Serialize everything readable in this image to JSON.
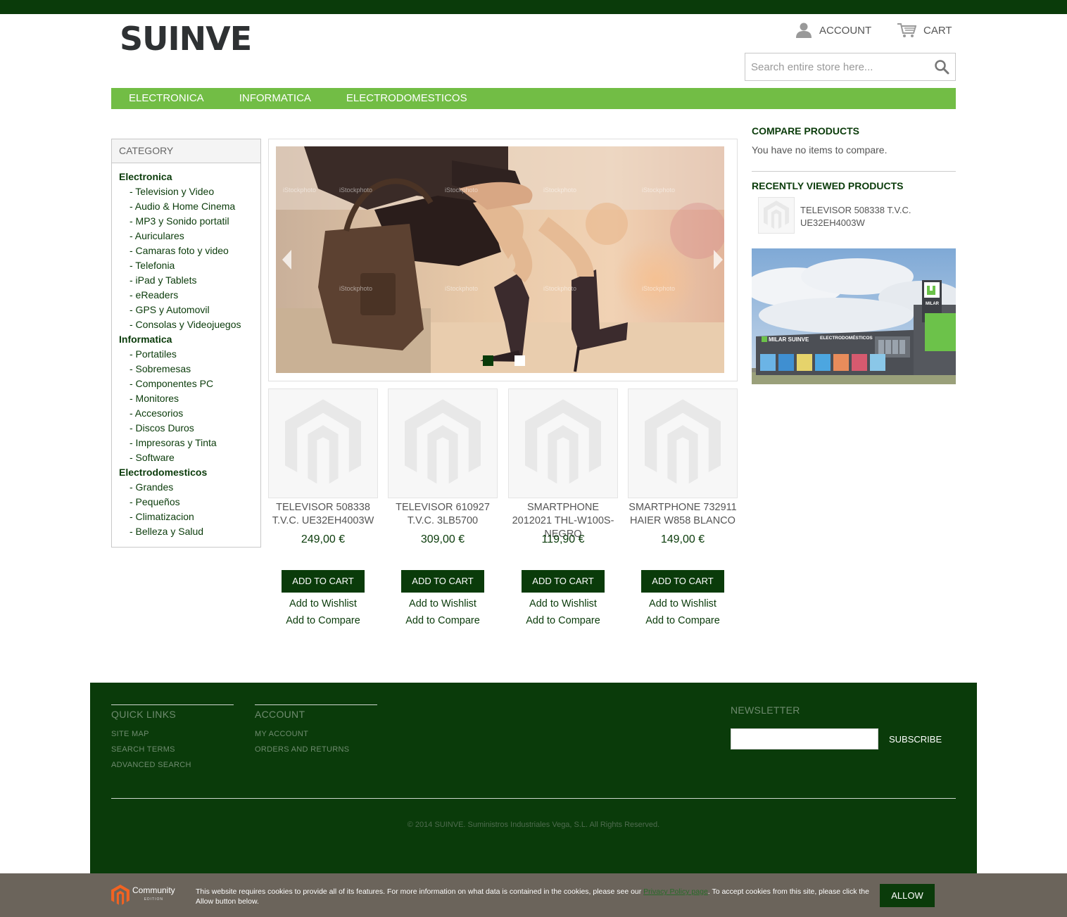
{
  "header": {
    "logo": "SUINVE",
    "account_label": "ACCOUNT",
    "cart_label": "CART",
    "search_placeholder": "Search entire store here..."
  },
  "nav": {
    "items": [
      "ELECTRONICA",
      "INFORMATICA",
      "ELECTRODOMESTICOS"
    ]
  },
  "category": {
    "title": "CATEGORY",
    "groups": [
      {
        "label": "Electronica",
        "items": [
          "- Television y Video",
          "- Audio & Home Cinema",
          "- MP3 y Sonido portatil",
          "- Auriculares",
          "- Camaras foto y video",
          "- Telefonia",
          "- iPad y Tablets",
          "- eReaders",
          "- GPS y Automovil",
          "- Consolas y Videojuegos"
        ]
      },
      {
        "label": "Informatica",
        "items": [
          "- Portatiles",
          "- Sobremesas",
          "- Componentes PC",
          "- Monitores",
          "- Accesorios",
          "- Discos Duros",
          "- Impresoras y Tinta",
          "- Software"
        ]
      },
      {
        "label": "Electrodomesticos",
        "items": [
          "- Grandes",
          "- Pequeños",
          "- Climatizacion",
          "- Belleza y Salud"
        ]
      }
    ]
  },
  "products": [
    {
      "name": "TELEVISOR 508338 T.V.C. UE32EH4003W",
      "price": "249,00 €"
    },
    {
      "name": "TELEVISOR 610927 T.V.C. 3LB5700",
      "price": "309,00 €"
    },
    {
      "name": "SMARTPHONE 2012021 THL-W100S-NEGRO",
      "price": "119,90 €"
    },
    {
      "name": "SMARTPHONE 732911 HAIER W858 BLANCO",
      "price": "149,00 €"
    }
  ],
  "product_actions": {
    "add_to_cart": "ADD TO CART",
    "add_to_wishlist": "Add to Wishlist",
    "add_to_compare": "Add to Compare"
  },
  "slider": {
    "slide_count": 2,
    "active_slide": 1,
    "watermark": "iStockphoto"
  },
  "sidebar": {
    "compare_title": "COMPARE PRODUCTS",
    "compare_text": "You have no items to compare.",
    "recent_title": "RECENTLY VIEWED PRODUCTS",
    "recent_product": "TELEVISOR 508338 T.V.C. UE32EH4003W",
    "store_sign_1": "MILAR SUINVE",
    "store_sign_2": "ELECTRODOMÉSTICOS",
    "store_tower": "MILAR"
  },
  "footer": {
    "quick_links_title": "QUICK LINKS",
    "quick_links": [
      "SITE MAP",
      "SEARCH TERMS",
      "ADVANCED SEARCH"
    ],
    "account_title": "ACCOUNT",
    "account_links": [
      "MY ACCOUNT",
      "ORDERS AND RETURNS"
    ],
    "newsletter_title": "NEWSLETTER",
    "subscribe_label": "SUBSCRIBE",
    "copyright": "© 2014 SUINVE. Suministros Industriales Vega, S.L. All Rights Reserved."
  },
  "cookie": {
    "edition_label": "Community",
    "edition_sub": "EDITION",
    "text_before": "This website requires cookies to provide all of its features. For more information on what data is contained in the cookies, please see our ",
    "link_text": "Privacy Policy page",
    "text_after": ". To accept cookies from this site, please click the Allow button below.",
    "allow_label": "ALLOW"
  },
  "colors": {
    "dark_green": "#0a3b0a",
    "nav_green": "#72bd45",
    "cookie_bar": "#6b645b"
  }
}
